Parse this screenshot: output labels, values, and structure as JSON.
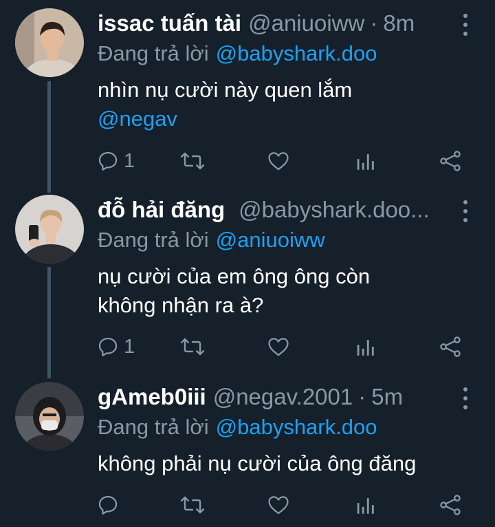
{
  "tweets": [
    {
      "name": "issac tuấn tài",
      "handle": "@aniuoiww",
      "separator": "·",
      "time": "8m",
      "replying_label": "Đang trả lời",
      "replying_to": "@babyshark.doo",
      "text_line1": "nhìn nụ cười này quen lắm",
      "text_mention": "@negav",
      "reply_count": "1",
      "avatar_colors": {
        "bg": "#c9b8a6",
        "skin": "#e2b99a",
        "hair": "#2a1f1a",
        "shirt": "#d9cfc4"
      }
    },
    {
      "name": "đỗ hải đăng",
      "handle": "@babyshark.doo...",
      "replying_label": "Đang trả lời",
      "replying_to": "@aniuoiww",
      "text_line1": "nụ cười của em ông ông còn",
      "text_line2": "không nhận ra à?",
      "reply_count": "1",
      "avatar_colors": {
        "bg": "#d6d3d0",
        "skin": "#e6c4ac",
        "hair": "#c6a27a",
        "shirt": "#2c2e33"
      }
    },
    {
      "name": "gAmeb0iii",
      "handle": "@negav.2001",
      "separator": "·",
      "time": "5m",
      "replying_label": "Đang trả lời",
      "replying_to": "@babyshark.doo",
      "text_line1": "không phải nụ cười của ông đăng",
      "reply_count": "",
      "avatar_colors": {
        "bg": "#3a3d44",
        "skin": "#d8b49a",
        "hair": "#1c1c1f",
        "shirt": "#2b2b30"
      }
    }
  ],
  "colors": {
    "background": "#15202b",
    "primary_text": "#ffffff",
    "secondary_text": "#8899a6",
    "accent": "#1da1f2",
    "thread_line": "#3d5466"
  },
  "icons": [
    "reply-icon",
    "retweet-icon",
    "like-icon",
    "analytics-icon",
    "share-icon",
    "more-options-icon"
  ]
}
